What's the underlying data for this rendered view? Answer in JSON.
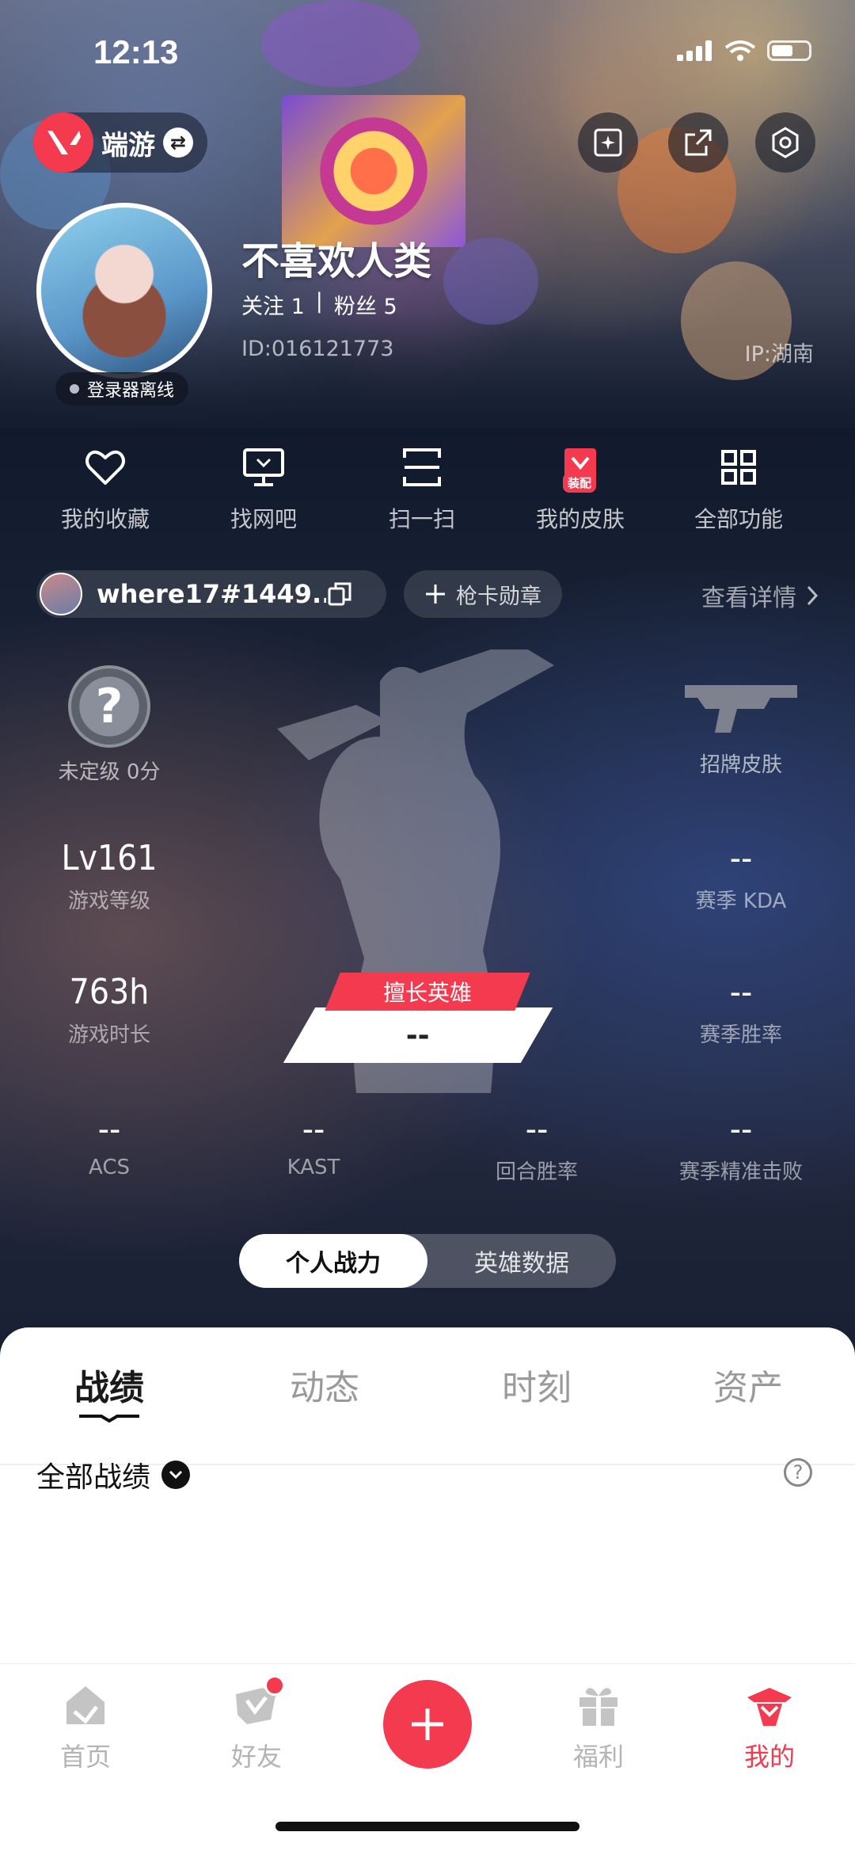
{
  "status": {
    "time": "12:13"
  },
  "header": {
    "brand_name": "端游",
    "nickname": "不喜欢人类",
    "follow_label": "关注 1",
    "divider": "|",
    "fans_label": "粉丝 5",
    "uid": "ID:016121773",
    "ip": "IP:湖南",
    "login_status": "登录器离线"
  },
  "quick_actions": [
    {
      "label": "我的收藏",
      "icon": "heart-icon"
    },
    {
      "label": "找网吧",
      "icon": "monitor-icon"
    },
    {
      "label": "扫一扫",
      "icon": "scan-icon"
    },
    {
      "label": "我的皮肤",
      "icon": "skin-icon",
      "badge": "装配"
    },
    {
      "label": "全部功能",
      "icon": "grid-icon"
    }
  ],
  "account": {
    "name": "where17#1449...",
    "medal_label": "枪卡勋章",
    "detail_label": "查看详情"
  },
  "stats": {
    "rank_symbol": "?",
    "rank_label": "未定级 0分",
    "signature_skin_label": "招牌皮肤",
    "level_value": "Lv161",
    "level_label": "游戏等级",
    "kda_value": "--",
    "kda_label": "赛季 KDA",
    "hours_value": "763h",
    "hours_label": "游戏时长",
    "winrate_value": "--",
    "winrate_label": "赛季胜率",
    "best_agent_tag": "擅长英雄",
    "best_agent_value": "--",
    "acs_value": "--",
    "acs_label": "ACS",
    "kast_value": "--",
    "kast_label": "KAST",
    "round_win_value": "--",
    "round_win_label": "回合胜率",
    "precise_value": "--",
    "precise_label": "赛季精准击败"
  },
  "segmented": {
    "left": "个人战力",
    "right": "英雄数据"
  },
  "tabs": [
    "战绩",
    "动态",
    "时刻",
    "资产"
  ],
  "filter": {
    "label": "全部战绩",
    "help": "?"
  },
  "nav": {
    "items": [
      {
        "label": "首页"
      },
      {
        "label": "好友"
      },
      {
        "label": "福利"
      },
      {
        "label": "我的"
      }
    ],
    "plus": "+"
  },
  "colors": {
    "accent": "#f33a4f",
    "sheet_bg": "#ffffff",
    "dark_bg": "#1c2438"
  }
}
